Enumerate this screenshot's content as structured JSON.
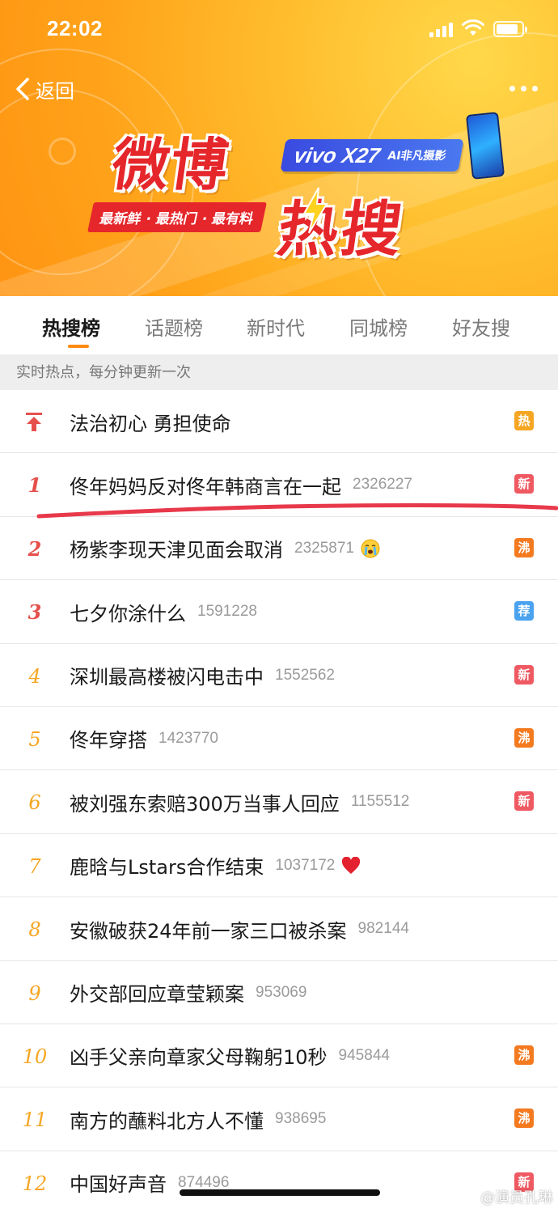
{
  "status_bar": {
    "time": "22:02"
  },
  "header": {
    "back_label": "返回",
    "logo_weibo": "微博",
    "logo_resou": "热搜",
    "sponsor_model": "vivo X27",
    "sponsor_tag": "AI非凡摄影",
    "slogan": "最新鲜 · 最热门 · 最有料"
  },
  "tabs": [
    {
      "label": "热搜榜",
      "active": true
    },
    {
      "label": "话题榜",
      "active": false
    },
    {
      "label": "新时代",
      "active": false
    },
    {
      "label": "同城榜",
      "active": false
    },
    {
      "label": "好友搜",
      "active": false
    }
  ],
  "subheader": "实时热点，每分钟更新一次",
  "colors": {
    "badge_hot": "#f5a623",
    "badge_new": "#ef5a62",
    "badge_boil": "#f47a20",
    "badge_recommend": "#4ba3f0",
    "accent": "#ff8b10",
    "annotation": "#e8394b"
  },
  "list": [
    {
      "rank": "",
      "pinned": true,
      "title": "法治初心 勇担使命",
      "count": "",
      "badge": "热",
      "badge_type": "hot"
    },
    {
      "rank": "1",
      "title": "佟年妈妈反对佟年韩商言在一起",
      "count": "2326227",
      "badge": "新",
      "badge_type": "new"
    },
    {
      "rank": "2",
      "title": "杨紫李现天津见面会取消",
      "count": "2325871",
      "emoji": "crying-face-icon",
      "badge": "沸",
      "badge_type": "boil"
    },
    {
      "rank": "3",
      "title": "七夕你涂什么",
      "count": "1591228",
      "badge": "荐",
      "badge_type": "recommend"
    },
    {
      "rank": "4",
      "title": "深圳最高楼被闪电击中",
      "count": "1552562",
      "badge": "新",
      "badge_type": "new"
    },
    {
      "rank": "5",
      "title": "佟年穿搭",
      "count": "1423770",
      "badge": "沸",
      "badge_type": "boil"
    },
    {
      "rank": "6",
      "title": "被刘强东索赔300万当事人回应",
      "count": "1155512",
      "badge": "新",
      "badge_type": "new"
    },
    {
      "rank": "7",
      "title": "鹿晗与Lstars合作结束",
      "count": "1037172",
      "emoji": "red-heart-icon",
      "badge": "",
      "badge_type": ""
    },
    {
      "rank": "8",
      "title": "安徽破获24年前一家三口被杀案",
      "count": "982144",
      "badge": "",
      "badge_type": ""
    },
    {
      "rank": "9",
      "title": "外交部回应章莹颖案",
      "count": "953069",
      "badge": "",
      "badge_type": ""
    },
    {
      "rank": "10",
      "title": "凶手父亲向章家父母鞠躬10秒",
      "count": "945844",
      "badge": "沸",
      "badge_type": "boil"
    },
    {
      "rank": "11",
      "title": "南方的蘸料北方人不懂",
      "count": "938695",
      "badge": "沸",
      "badge_type": "boil"
    },
    {
      "rank": "12",
      "title": "中国好声音",
      "count": "874496",
      "badge": "新",
      "badge_type": "new"
    }
  ],
  "watermark": "@演员孔琳"
}
